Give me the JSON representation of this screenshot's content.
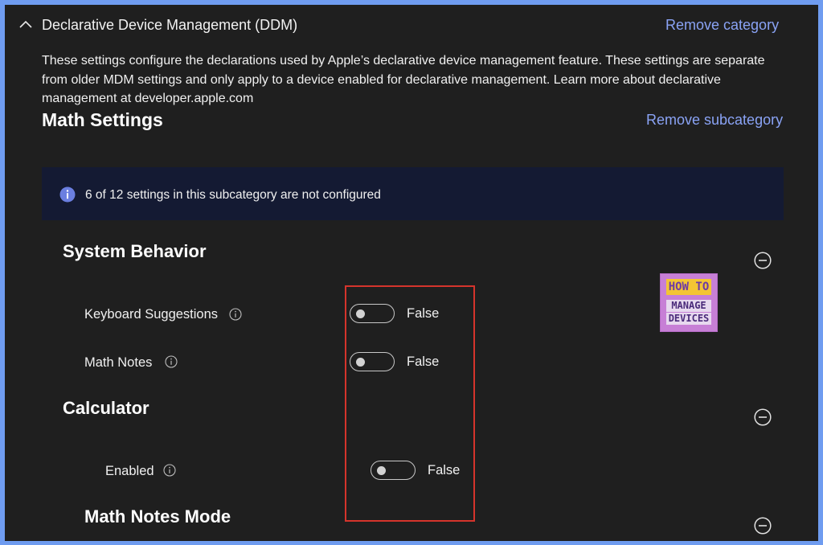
{
  "category": {
    "title": "Declarative Device Management (DDM)",
    "remove_label": "Remove category",
    "description": "These settings configure the declarations used by Apple’s declarative device management feature. These settings are separate from older MDM settings and only apply to a device enabled for declarative management. Learn more about declarative management at developer.apple.com"
  },
  "subcategory": {
    "title": "Math Settings",
    "remove_label": "Remove subcategory",
    "info_banner": "6 of 12 settings in this subcategory are not configured"
  },
  "groups": [
    {
      "title": "System Behavior",
      "settings": [
        {
          "label": "Keyboard Suggestions",
          "value": "False",
          "on": false
        },
        {
          "label": "Math Notes",
          "value": "False",
          "on": false
        }
      ]
    },
    {
      "title": "Calculator",
      "settings": [
        {
          "label": "Enabled",
          "value": "False",
          "on": false
        }
      ]
    },
    {
      "title": "Math Notes Mode",
      "settings": []
    }
  ],
  "logo": {
    "line1": "HOW TO",
    "line2": "MANAGE",
    "line3": "DEVICES"
  },
  "colors": {
    "background": "#1f1f1f",
    "link": "#8aa3f5",
    "banner": "#141a33",
    "highlight_box": "#d5342c",
    "info_icon": "#6b7fe0"
  },
  "icons": {
    "collapse_category": "chevron-up-icon",
    "info": "info-icon",
    "help": "info-circle-icon",
    "collapse_group": "minus-circle-icon"
  }
}
